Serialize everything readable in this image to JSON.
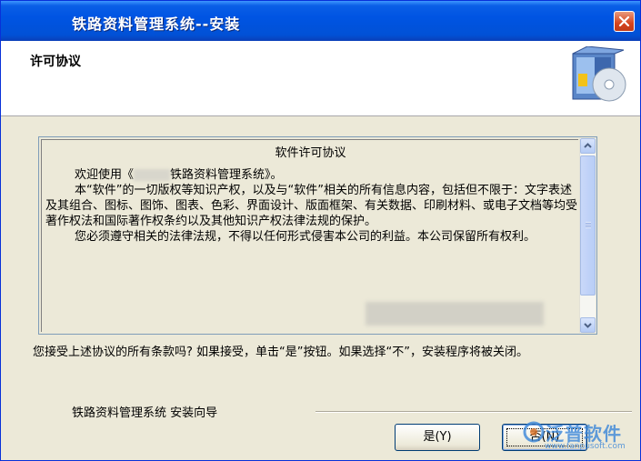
{
  "window": {
    "title": "铁路资料管理系统--安装"
  },
  "header": {
    "title": "许可协议",
    "icon": "setup-box-icon"
  },
  "license": {
    "heading": "软件许可协议",
    "line1_prefix": "欢迎使用《",
    "line1_suffix": "铁路资料管理系统》。",
    "paragraph2": "本“软件”的一切版权等知识产权，以及与“软件”相关的所有信息内容，包括但不限于：文字表述及其组合、图标、图饰、图表、色彩、界面设计、版面框架、有关数据、印刷材料、或电子文档等均受著作权法和国际著作权条约以及其他知识产权法律法规的保护。",
    "paragraph3": "您必须遵守相关的法律法规，不得以任何形式侵害本公司的利益。本公司保留所有权利。"
  },
  "question": "您接受上述协议的所有条款吗? 如果接受，单击“是”按钮。如果选择“不”，安装程序将被关闭。",
  "footer": {
    "wizard_label": "铁路资料管理系统 安装向导"
  },
  "buttons": {
    "yes": "是(Y)",
    "no": "否(N)"
  },
  "watermark": {
    "text": "泛普软件",
    "sub": "www.fanpusoft.com"
  },
  "colors": {
    "title_bar": "#0054e3",
    "close_button": "#d6441e",
    "dialog_bg": "#ece9d8"
  }
}
